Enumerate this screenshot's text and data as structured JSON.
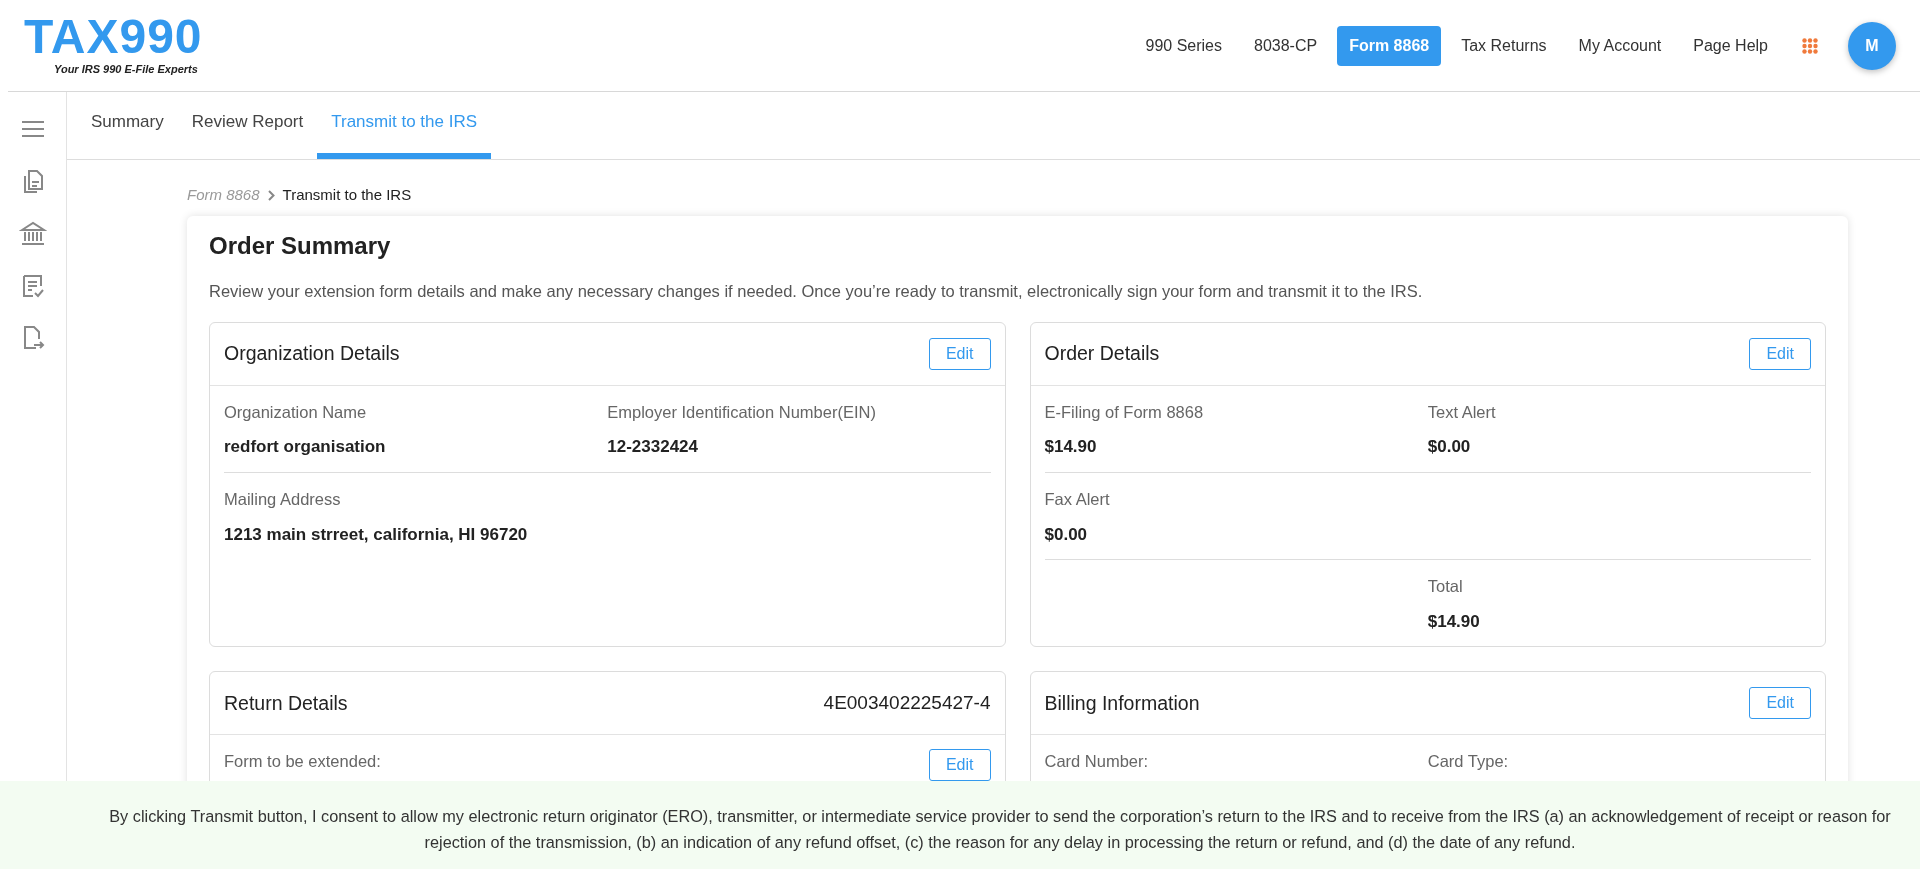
{
  "logo": {
    "name": "TAX990",
    "tagline": "Your IRS 990 E-File Experts"
  },
  "nav": [
    {
      "label": "990 Series",
      "selected": false
    },
    {
      "label": "8038-CP",
      "selected": false
    },
    {
      "label": "Form 8868",
      "selected": true
    },
    {
      "label": "Tax Returns",
      "selected": false
    },
    {
      "label": "My Account",
      "selected": false
    },
    {
      "label": "Page Help",
      "selected": false
    }
  ],
  "avatar": {
    "initial": "M"
  },
  "tabs": [
    {
      "label": "Summary",
      "selected": false
    },
    {
      "label": "Review Report",
      "selected": false
    },
    {
      "label": "Transmit to the IRS",
      "selected": true
    }
  ],
  "breadcrumb": [
    {
      "label": "Form 8868",
      "kind": "link"
    },
    {
      "label": "Transmit to the IRS",
      "kind": "current"
    }
  ],
  "order_summary": {
    "title": "Order Summary",
    "description": "Review your extension form details and make any necessary changes if needed. Once you’re ready to transmit, electronically sign your form and transmit it to the IRS."
  },
  "columns": [
    {
      "cards": [
        {
          "title": "Organization Details",
          "edit_button": "Edit",
          "rows": [
            [
              {
                "label": "Organization Name",
                "value": "redfort organisation"
              },
              {
                "label": "Employer Identification Number(EIN)",
                "value": "12-2332424"
              }
            ],
            [
              {
                "label": "Mailing Address",
                "value": "1213 main strreet, california, HI 96720"
              }
            ]
          ]
        },
        {
          "title": "Return Details",
          "header_value": "4E003402225427-4",
          "rows": [
            [
              {
                "label": "Form to be extended:",
                "edit_button": "Edit"
              }
            ]
          ]
        }
      ]
    },
    {
      "cards": [
        {
          "title": "Order Details",
          "edit_button": "Edit",
          "rows": [
            [
              {
                "label": "E-Filing of Form 8868",
                "value": "$14.90"
              },
              {
                "label": "Text Alert",
                "value": "$0.00"
              }
            ],
            [
              {
                "label": "Fax Alert",
                "value": "$0.00"
              }
            ],
            [
              "",
              {
                "label": "Total",
                "value": "$14.90"
              }
            ]
          ]
        },
        {
          "title": "Billing Information",
          "edit_button": "Edit",
          "rows": [
            [
              {
                "label": "Card Number:"
              },
              {
                "label": "Card Type:"
              }
            ]
          ]
        }
      ]
    }
  ],
  "consent": "By clicking Transmit button, I consent to allow my electronic return originator (ERO), transmitter, or intermediate service provider to send the corporation’s return to the IRS and to receive from the IRS (a) an acknowledgement of receipt or reason for rejection of the transmission, (b) an indication of any refund offset, (c) the reason for any delay in processing the return or refund, and (d) the date of any refund."
}
